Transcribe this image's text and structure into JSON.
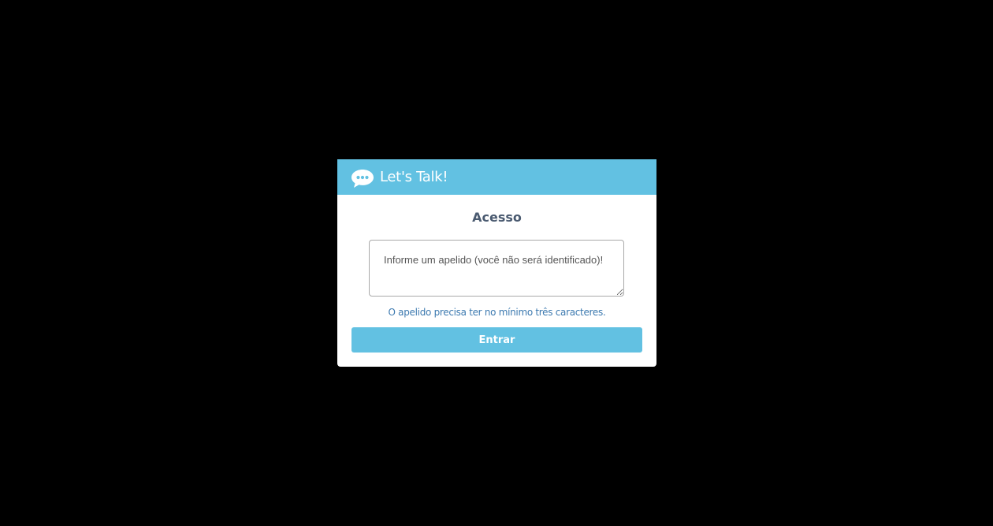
{
  "header": {
    "title": "Let's Talk!",
    "icon": "chat-bubble-icon"
  },
  "login": {
    "title": "Acesso",
    "nickname_placeholder": "Informe um apelido (você não será identificado)!",
    "nickname_value": "",
    "hint": "O apelido precisa ter no mínimo três caracteres.",
    "submit_label": "Entrar"
  },
  "colors": {
    "background": "#000000",
    "accent": "#62c1e2",
    "title_text": "#4a5a70",
    "hint_text": "#3d7ab0"
  }
}
